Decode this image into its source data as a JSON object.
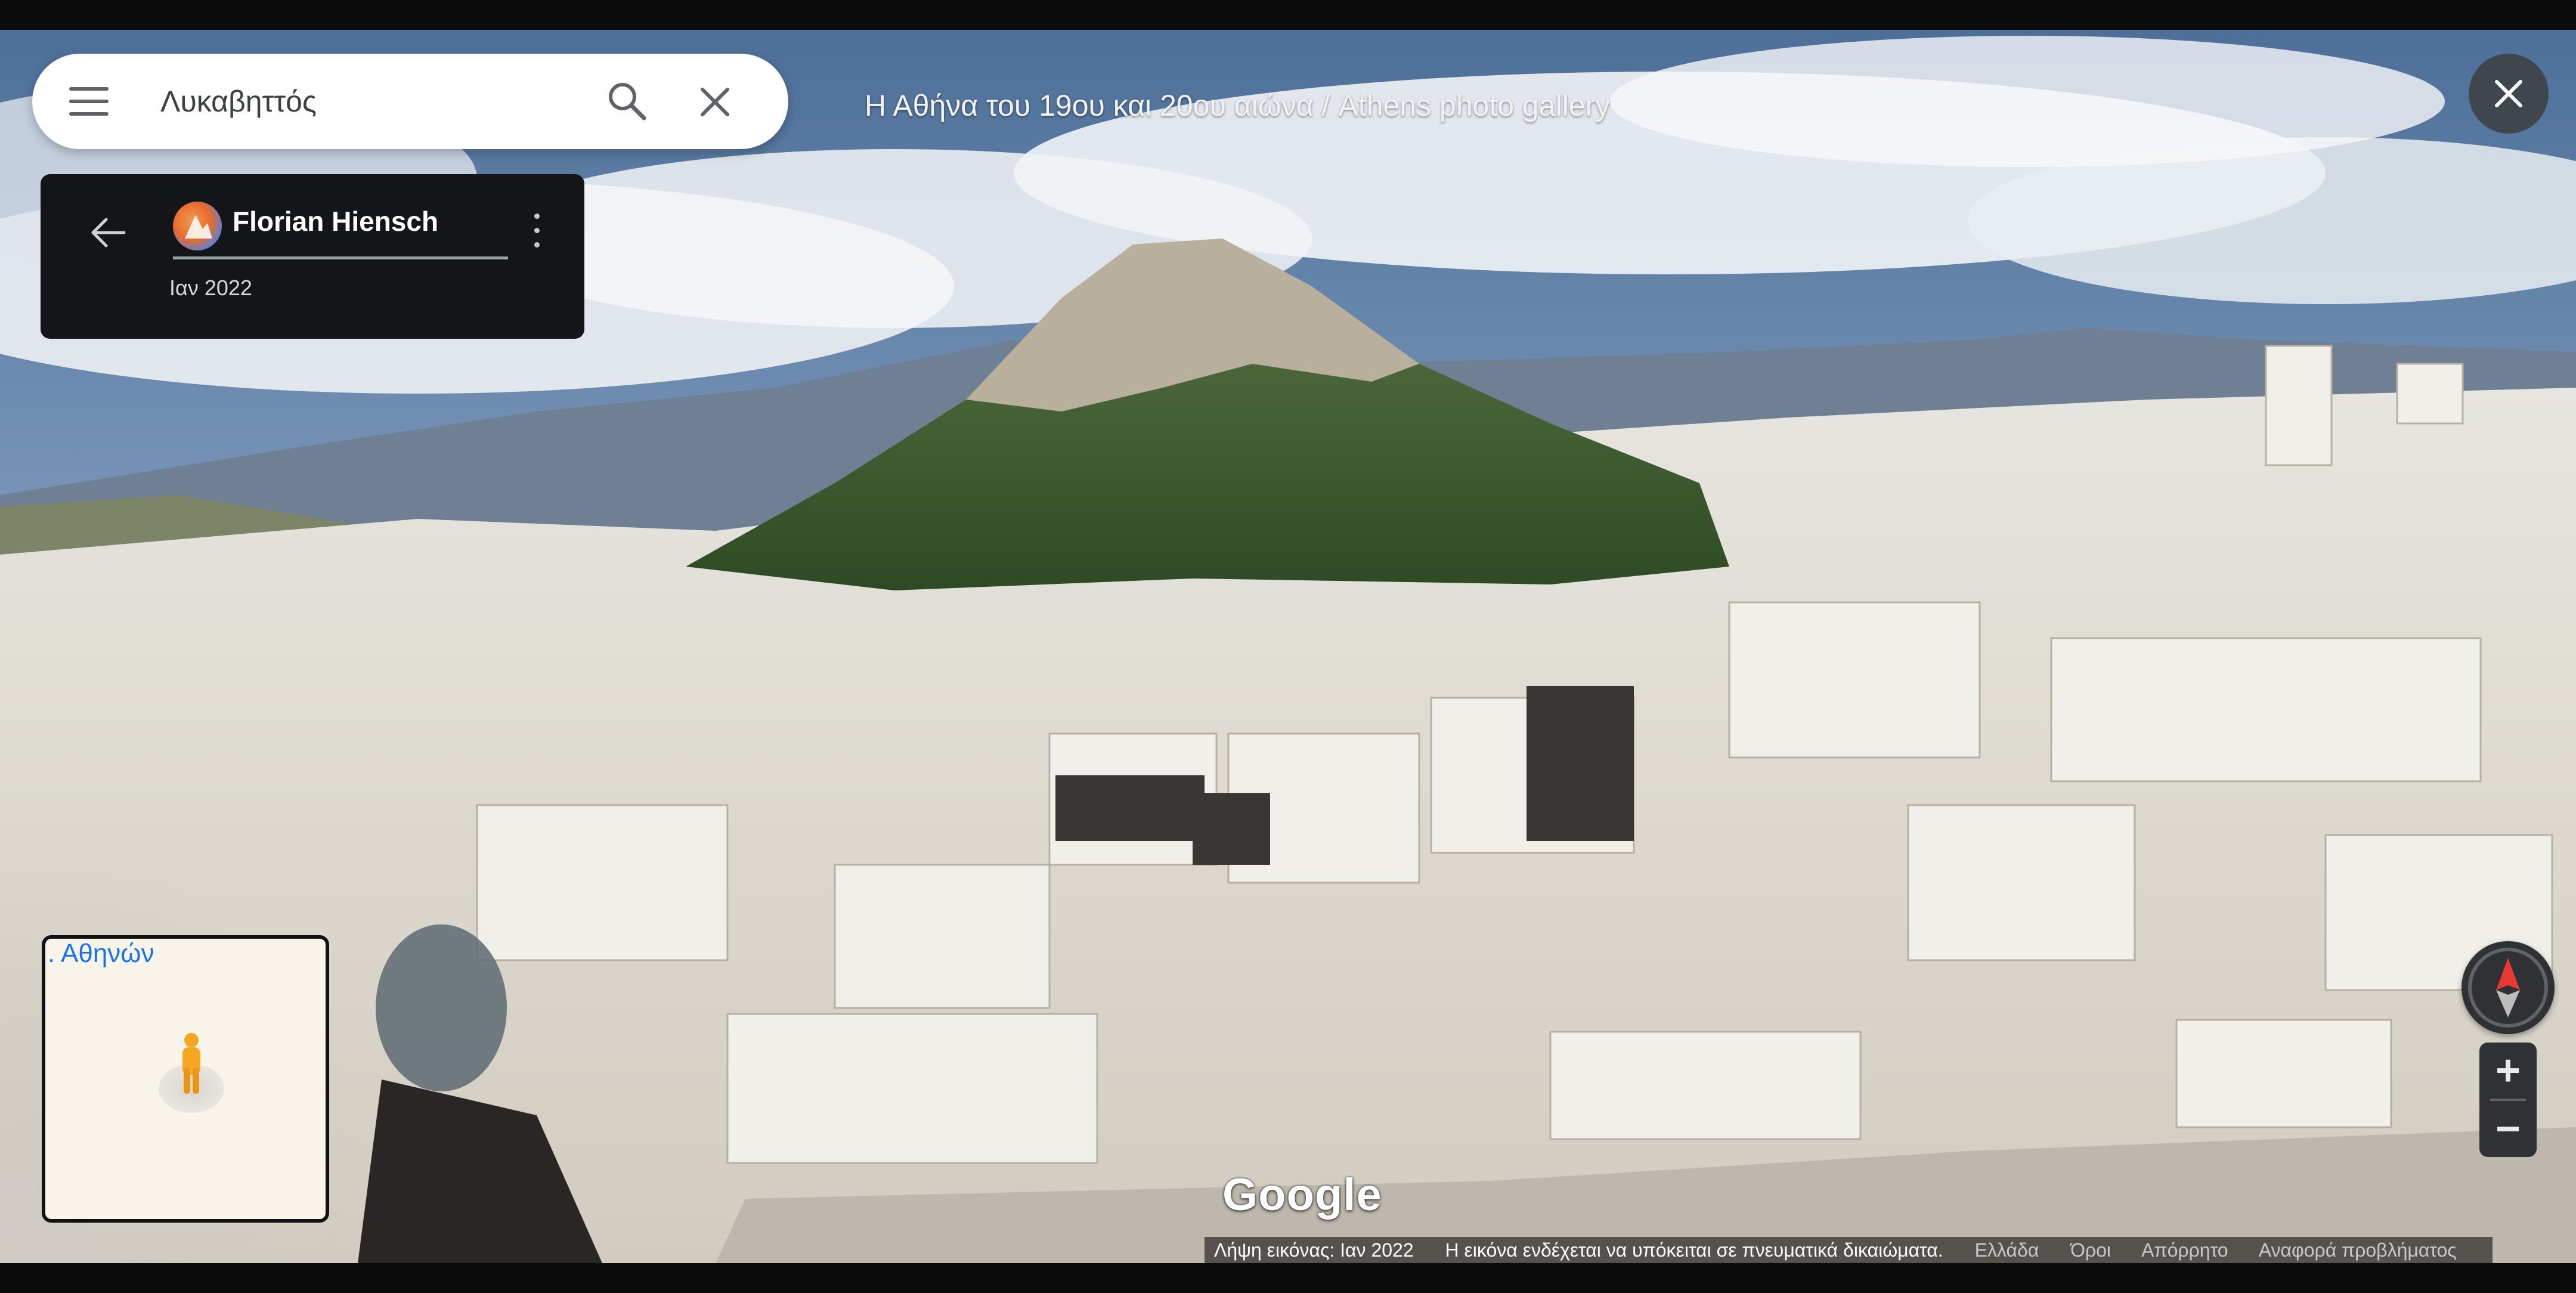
{
  "search": {
    "query": "Λυκαβηττός"
  },
  "gallery": {
    "title": "Η Αθήνα του 19ου και 20ου αιώνα / Athens photo gallery"
  },
  "author": {
    "name": "Florian Hiensch",
    "date": "Ιαν 2022"
  },
  "minimap": {
    "label": ". Αθηνών"
  },
  "zoom": {
    "in_label": "+",
    "out_label": "−"
  },
  "brand": {
    "logo_text": "Google"
  },
  "footer": {
    "capture_date": "Λήψη εικόνας: Ιαν 2022",
    "copyright": "Η εικόνα ενδέχεται να υπόκειται σε πνευματικά δικαιώματα.",
    "country": "Ελλάδα",
    "terms": "Όροι",
    "privacy": "Απόρρητο",
    "report": "Αναφορά προβλήματος"
  },
  "icons": {
    "menu": "menu-icon",
    "search": "search-icon",
    "clear": "close-icon",
    "back": "arrow-back-icon",
    "more": "more-vert-icon",
    "close_viewer": "close-icon",
    "compass": "compass-icon",
    "pegman": "pegman-icon"
  },
  "colors": {
    "accent": "#1a73e8",
    "panel_dark": "#141518",
    "control_dark": "#2f3134",
    "pegman": "#f5a623"
  }
}
